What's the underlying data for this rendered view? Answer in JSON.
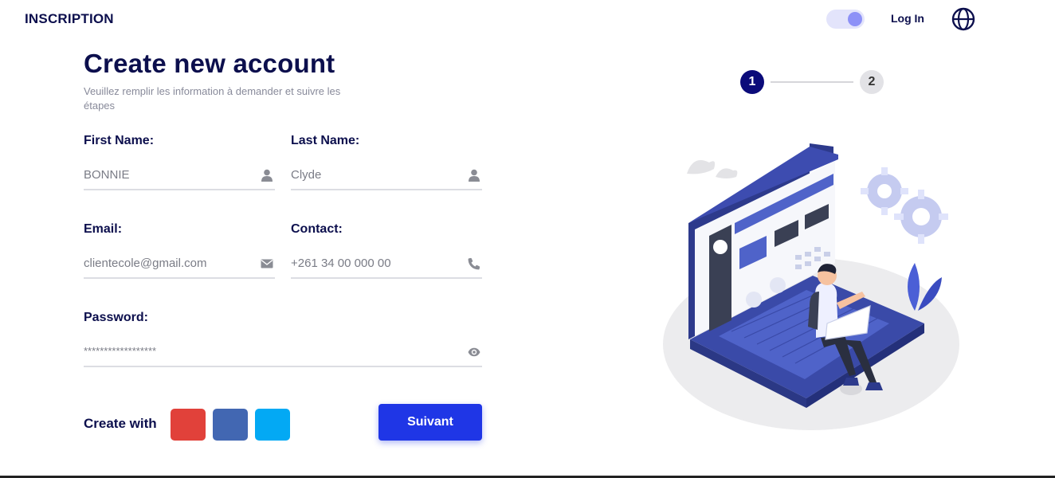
{
  "header": {
    "brand": "INSCRIPTION",
    "login_label": "Log In",
    "toggle_on": true
  },
  "form": {
    "title": "Create new account",
    "subtitle": "Veuillez remplir les information à demander et suivre les étapes",
    "first_name": {
      "label": "First Name:",
      "value": "BONNIE",
      "icon": "user-icon"
    },
    "last_name": {
      "label": "Last Name:",
      "value": "Clyde",
      "icon": "user-icon"
    },
    "email": {
      "label": "Email:",
      "value": "clientecole@gmail.com",
      "icon": "envelope-icon"
    },
    "contact": {
      "label": "Contact:",
      "value": "+261 34 00 000 00",
      "icon": "phone-icon"
    },
    "password": {
      "label": "Password:",
      "value": "******************",
      "icon": "eye-icon"
    },
    "create_with_label": "Create with",
    "social": [
      {
        "name": "google",
        "color": "#e1413a"
      },
      {
        "name": "facebook",
        "color": "#4267b2"
      },
      {
        "name": "twitter",
        "color": "#03a9f4"
      }
    ],
    "next_label": "Suivant"
  },
  "stepper": {
    "steps": [
      "1",
      "2"
    ],
    "active_step": 1
  },
  "colors": {
    "primary": "#0c0f4d",
    "accent": "#1f36e6",
    "muted": "#7a7c86"
  }
}
